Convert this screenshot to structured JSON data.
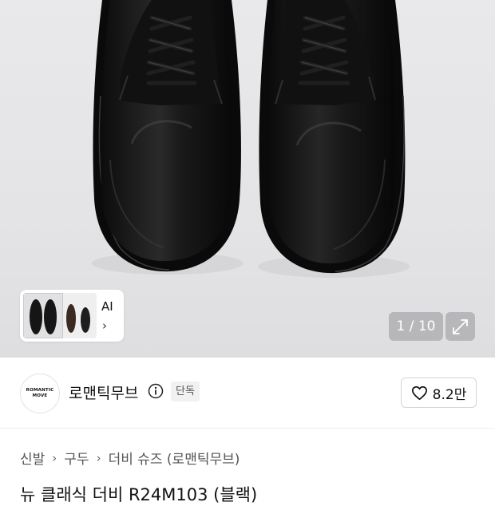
{
  "gallery": {
    "thumb_label": "AI",
    "thumb_chevron": "›",
    "counter": "1 / 10",
    "expand_icon": "expand-icon"
  },
  "brand": {
    "logo_line1": "ROMANTIC",
    "logo_line2": "MOVE",
    "name": "로맨틱무브",
    "info_icon": "info-icon",
    "badge": "단독",
    "like_icon": "heart-icon",
    "like_count": "8.2만"
  },
  "breadcrumb": {
    "items": [
      "신발",
      "구두",
      "더비 슈즈 (로맨틱무브)"
    ],
    "separator": "›"
  },
  "product": {
    "title": "뉴 클래식 더비 R24M103 (블랙)"
  },
  "colors": {
    "hero_bg": "#e6e6e8",
    "shoe": "#141414",
    "overlay": "#96969b"
  }
}
